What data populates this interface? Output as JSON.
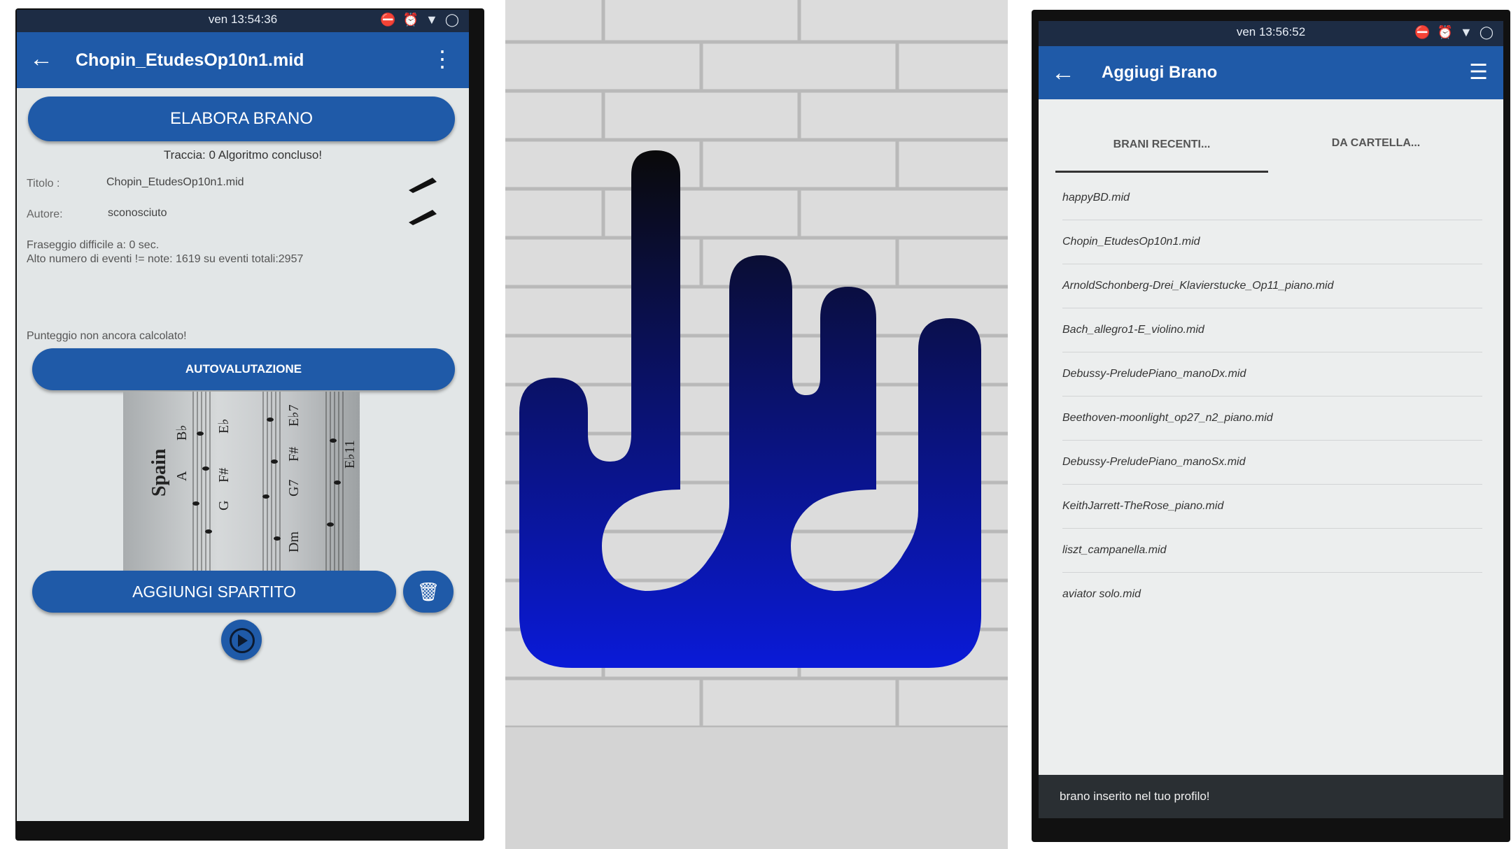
{
  "left_screen": {
    "status_time": "ven 13:54:36",
    "title": "Chopin_EtudesOp10n1.mid",
    "elabora_label": "ELABORA BRANO",
    "track_status": "Traccia: 0 Algoritmo concluso!",
    "title_label": "Titolo :",
    "title_value": "Chopin_EtudesOp10n1.mid",
    "author_label": "Autore:",
    "author_value": "sconosciuto",
    "phrasing": "Fraseggio difficile a: 0 sec.",
    "events": "Alto numero di eventi != note: 1619 su eventi totali:2957",
    "score_status": "Punteggio non ancora calcolato!",
    "autoval_label": "AUTOVALUTAZIONE",
    "sheet_words": [
      "Spain",
      "B♭",
      "A",
      "G",
      "F#",
      "E♭",
      "G7",
      "F#",
      "E♭7",
      "Dm",
      "E♭11"
    ],
    "add_sheet_label": "AGGIUNGI SPARTITO"
  },
  "right_screen": {
    "status_time": "ven 13:56:52",
    "title": "Aggiugi Brano",
    "tabs": [
      "BRANI RECENTI...",
      "DA CARTELLA..."
    ],
    "files": [
      "happyBD.mid",
      "Chopin_EtudesOp10n1.mid",
      "ArnoldSchonberg-Drei_Klavierstucke_Op11_piano.mid",
      "Bach_allegro1-E_violino.mid",
      "Debussy-PreludePiano_manoDx.mid",
      "Beethoven-moonlight_op27_n2_piano.mid",
      "Debussy-PreludePiano_manoSx.mid",
      "KeithJarrett-TheRose_piano.mid",
      "liszt_campanella.mid",
      "aviator solo.mid"
    ],
    "snackbar": "brano inserito nel tuo profilo!"
  },
  "colors": {
    "accent": "#1f5aa8",
    "status_bar": "#1d2c44",
    "logo_top": "#0a0a0a",
    "logo_bottom": "#0a1ad8"
  },
  "icons": [
    "back-arrow-icon",
    "overflow-menu-icon",
    "pencil-icon",
    "trash-icon",
    "play-icon",
    "hamburger-menu-icon",
    "wifi-icon",
    "alarm-icon",
    "battery-icon",
    "dnd-icon"
  ]
}
